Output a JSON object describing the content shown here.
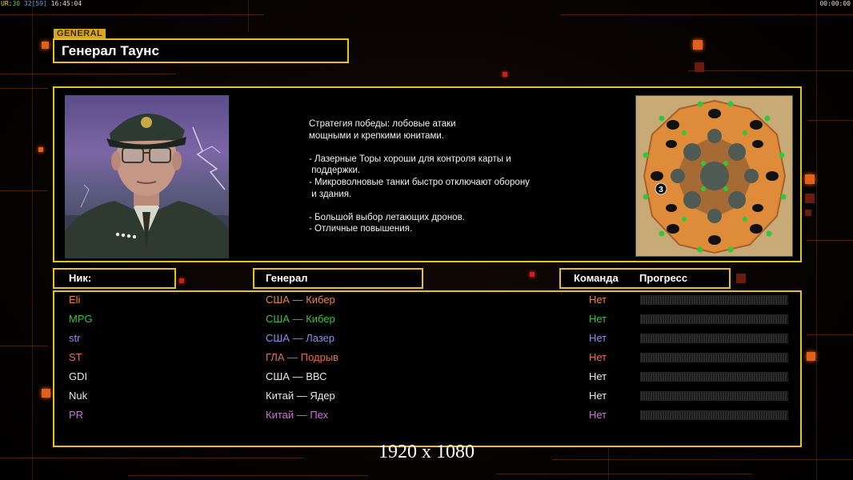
{
  "hud": {
    "ur_label": "UR:",
    "v1": "30",
    "v2": "32",
    "v3": "[59]",
    "time": "16:45:04",
    "timer": "00:00:00"
  },
  "header": {
    "tag": "GENERAL",
    "title": "Генерал Таунс"
  },
  "general_info": {
    "description": "Стратегия победы: лобовые атаки\nмощными и крепкими юнитами.\n\n- Лазерные Торы хороши для контроля карты и\n поддержки.\n- Микроволновые танки быстро отключают оборону\n и здания.\n\n- Большой выбор летающих дронов.\n- Отличные повышения.",
    "map_marker": "3"
  },
  "columns": {
    "nick": "Ник:",
    "general": "Генерал",
    "team": "Команда",
    "progress": "Прогресс"
  },
  "players": [
    {
      "nick": "Eli",
      "general": "США — Кибер",
      "team": "Нет",
      "color": "#e8843a",
      "progress": 0
    },
    {
      "nick": "MPG",
      "general": "США — Кибер",
      "team": "Нет",
      "color": "#3cc03c",
      "progress": 0
    },
    {
      "nick": "str",
      "general": "США — Лазер",
      "team": "Нет",
      "color": "#8a8ef0",
      "progress": 0
    },
    {
      "nick": "ST",
      "general": "ГЛА — Подрыв",
      "team": "Нет",
      "color": "#e0704a",
      "progress": 0
    },
    {
      "nick": "GDI",
      "general": "США — ВВС",
      "team": "Нет",
      "color": "#e6e6e6",
      "progress": 0
    },
    {
      "nick": "Nuk",
      "general": "Китай — Ядер",
      "team": "Нет",
      "color": "#e6e6e6",
      "progress": 0
    },
    {
      "nick": "PR",
      "general": "Китай — Пех",
      "team": "Нет",
      "color": "#d070e0",
      "progress": 0
    }
  ],
  "footer": {
    "resolution": "1920 x 1080"
  },
  "colors": {
    "frame": "#e8c020",
    "accent": "#e0601c"
  }
}
